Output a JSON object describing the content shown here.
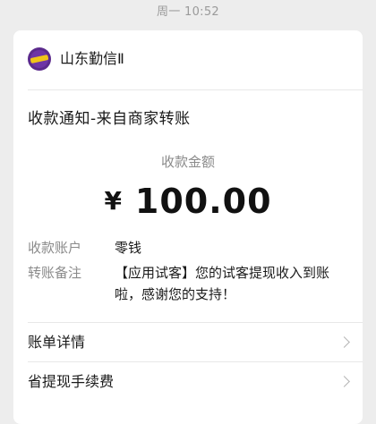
{
  "timestamp": "周一 10:52",
  "header": {
    "account_name": "山东勤信Ⅱ",
    "avatar_icon": "brand-logo-icon"
  },
  "notice": {
    "title": "收款通知-来自商家转账",
    "amount_label": "收款金额",
    "currency_symbol": "¥",
    "amount": "100.00"
  },
  "details": [
    {
      "label": "收款账户",
      "value": "零钱"
    },
    {
      "label": "转账备注",
      "value": "【应用试客】您的试客提现收入到账啦，感谢您的支持！"
    }
  ],
  "links": [
    {
      "label": "账单详情",
      "icon": "chevron-right-icon"
    },
    {
      "label": "省提现手续费",
      "icon": "chevron-right-icon"
    }
  ],
  "colors": {
    "background": "#ededed",
    "card": "#ffffff",
    "text_primary": "#1a1a1a",
    "text_secondary": "#8a8a8a",
    "avatar_purple": "#5b2a8c",
    "avatar_yellow": "#f0c419"
  }
}
